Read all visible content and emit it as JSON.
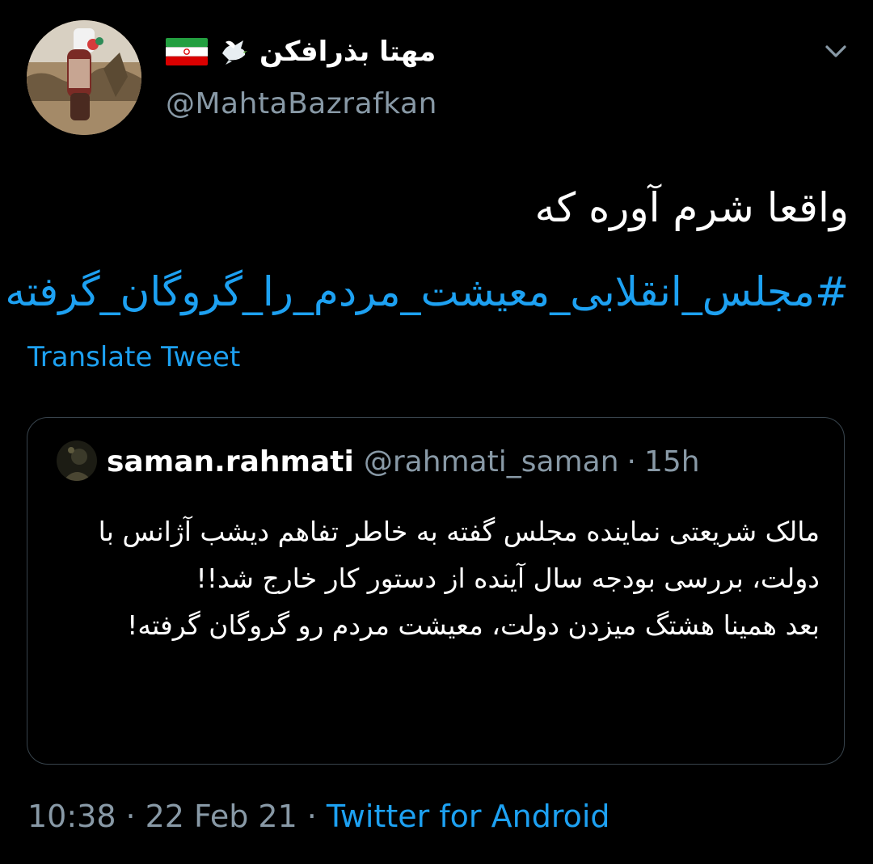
{
  "author": {
    "display_name": "مهتا بذرافکن",
    "handle": "@MahtaBazrafkan",
    "avatar_icon": "profile-photo",
    "emoji_icons": [
      "dove-icon",
      "iran-flag-icon"
    ]
  },
  "tweet": {
    "text_plain": "واقعا شرم آوره که ",
    "hashtag": "#مجلس_انقلابی_معیشت_مردم_را_گروگان_گرفته",
    "translate_label": "Translate Tweet"
  },
  "quoted_tweet": {
    "display_name": "saman.rahmati",
    "handle": "@rahmati_saman",
    "separator": "·",
    "time": "15h",
    "text": "مالک شریعتی نماینده مجلس گفته به خاطر تفاهم دیشب آژانس با دولت، بررسی بودجه سال آینده از دستور کار خارج شد!!\nبعد همینا هشتگ میزدن دولت، معیشت مردم رو گروگان گرفته!"
  },
  "footer": {
    "time": "10:38",
    "separator": "·",
    "date": "22 Feb 21",
    "source": "Twitter for Android"
  },
  "colors": {
    "background": "#000000",
    "accent": "#1da1f2",
    "muted": "#8899a6",
    "border": "#38444d"
  }
}
